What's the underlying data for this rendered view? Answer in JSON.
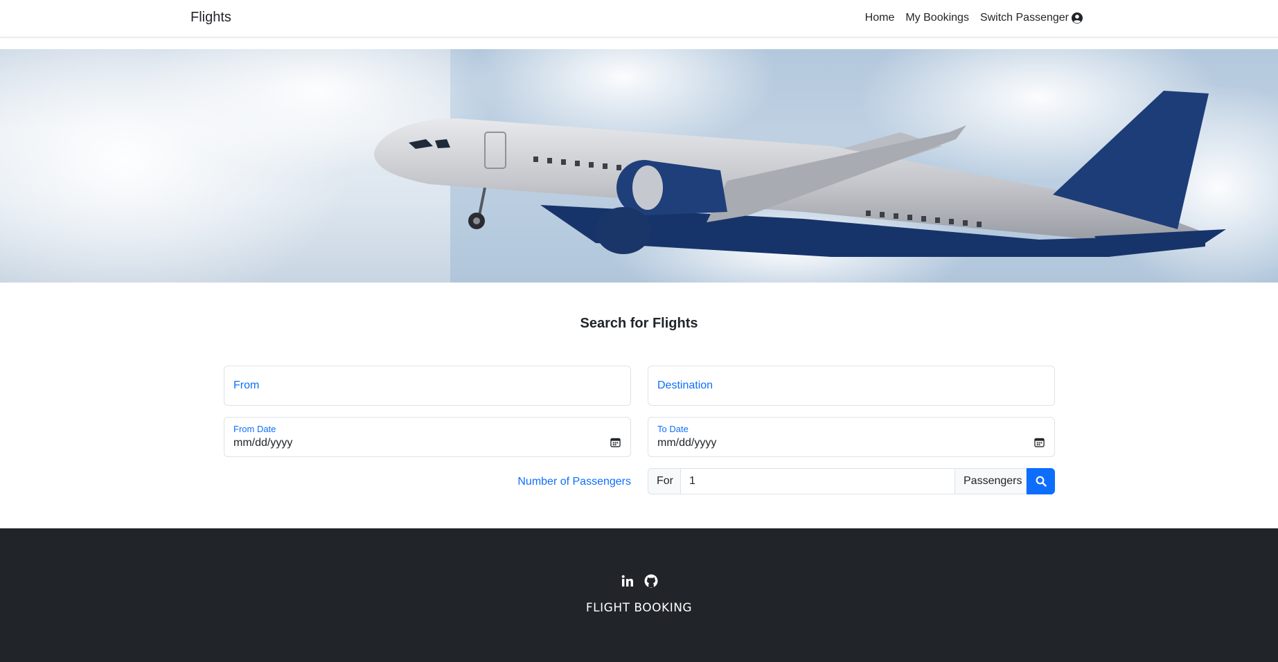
{
  "navbar": {
    "brand": "Flights",
    "links": [
      {
        "label": "Home"
      },
      {
        "label": "My Bookings"
      },
      {
        "label": "Switch Passenger",
        "icon": "user-circle-icon"
      }
    ]
  },
  "hero": {
    "image": "airplane-taking-off"
  },
  "search": {
    "title": "Search for Flights",
    "from_label": "From",
    "destination_label": "Destination",
    "from_date_label": "From Date",
    "from_date_value": "mm/dd/yyyy",
    "to_date_label": "To Date",
    "to_date_value": "mm/dd/yyyy",
    "passengers_label": "Number of Passengers",
    "for_text": "For",
    "passengers_value": "1",
    "passengers_suffix": "Passengers",
    "search_icon": "search-icon"
  },
  "footer": {
    "icons": [
      "linkedin-icon",
      "github-icon"
    ],
    "text": "FLIGHT BOOKING"
  },
  "colors": {
    "accent": "#0d6efd",
    "footer_bg": "#212529"
  }
}
